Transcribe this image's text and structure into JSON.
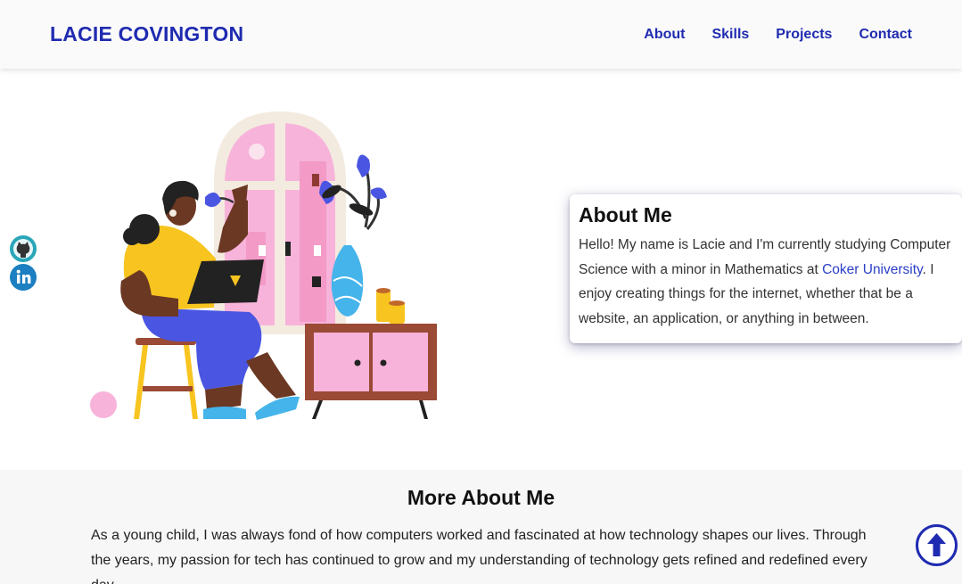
{
  "header": {
    "brand": "LACIE COVINGTON",
    "nav": [
      "About",
      "Skills",
      "Projects",
      "Contact"
    ]
  },
  "social": {
    "github_icon": "github-icon",
    "linkedin_icon": "linkedin-icon"
  },
  "about": {
    "title": "About Me",
    "text_before_link": "Hello! My name is Lacie and I'm currently studying Computer Science with a minor in Mathematics at ",
    "link_text": "Coker University",
    "text_after_link": ". I enjoy creating things for the internet, whether that be a website, an application, or anything in between."
  },
  "more": {
    "title": "More About Me",
    "text": "As a young child, I was always fond of how computers worked and fascinated at how technology shapes our lives. Through the years, my passion for tech has continued to grow and my understanding of technology gets refined and redefined every day."
  },
  "scroll_top_icon": "arrow-up-circle-icon",
  "colors": {
    "brand_blue": "#1f2bb0",
    "link_blue": "#2b3fc7",
    "pink": "#f7b3da",
    "yellow": "#f8c41f",
    "purple_blue": "#4a56e2",
    "brown": "#9a4a35"
  }
}
